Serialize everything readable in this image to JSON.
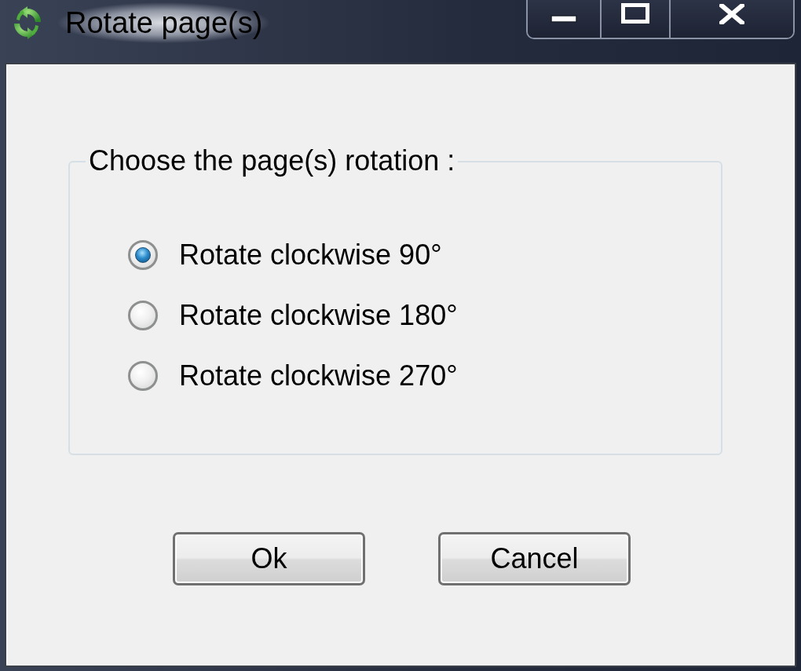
{
  "window": {
    "title": "Rotate page(s)"
  },
  "group": {
    "title": "Choose the page(s) rotation :",
    "options": [
      {
        "label": "Rotate clockwise 90°",
        "selected": true
      },
      {
        "label": "Rotate clockwise 180°",
        "selected": false
      },
      {
        "label": "Rotate clockwise 270°",
        "selected": false
      }
    ]
  },
  "buttons": [
    {
      "label": "Ok"
    },
    {
      "label": "Cancel"
    }
  ]
}
